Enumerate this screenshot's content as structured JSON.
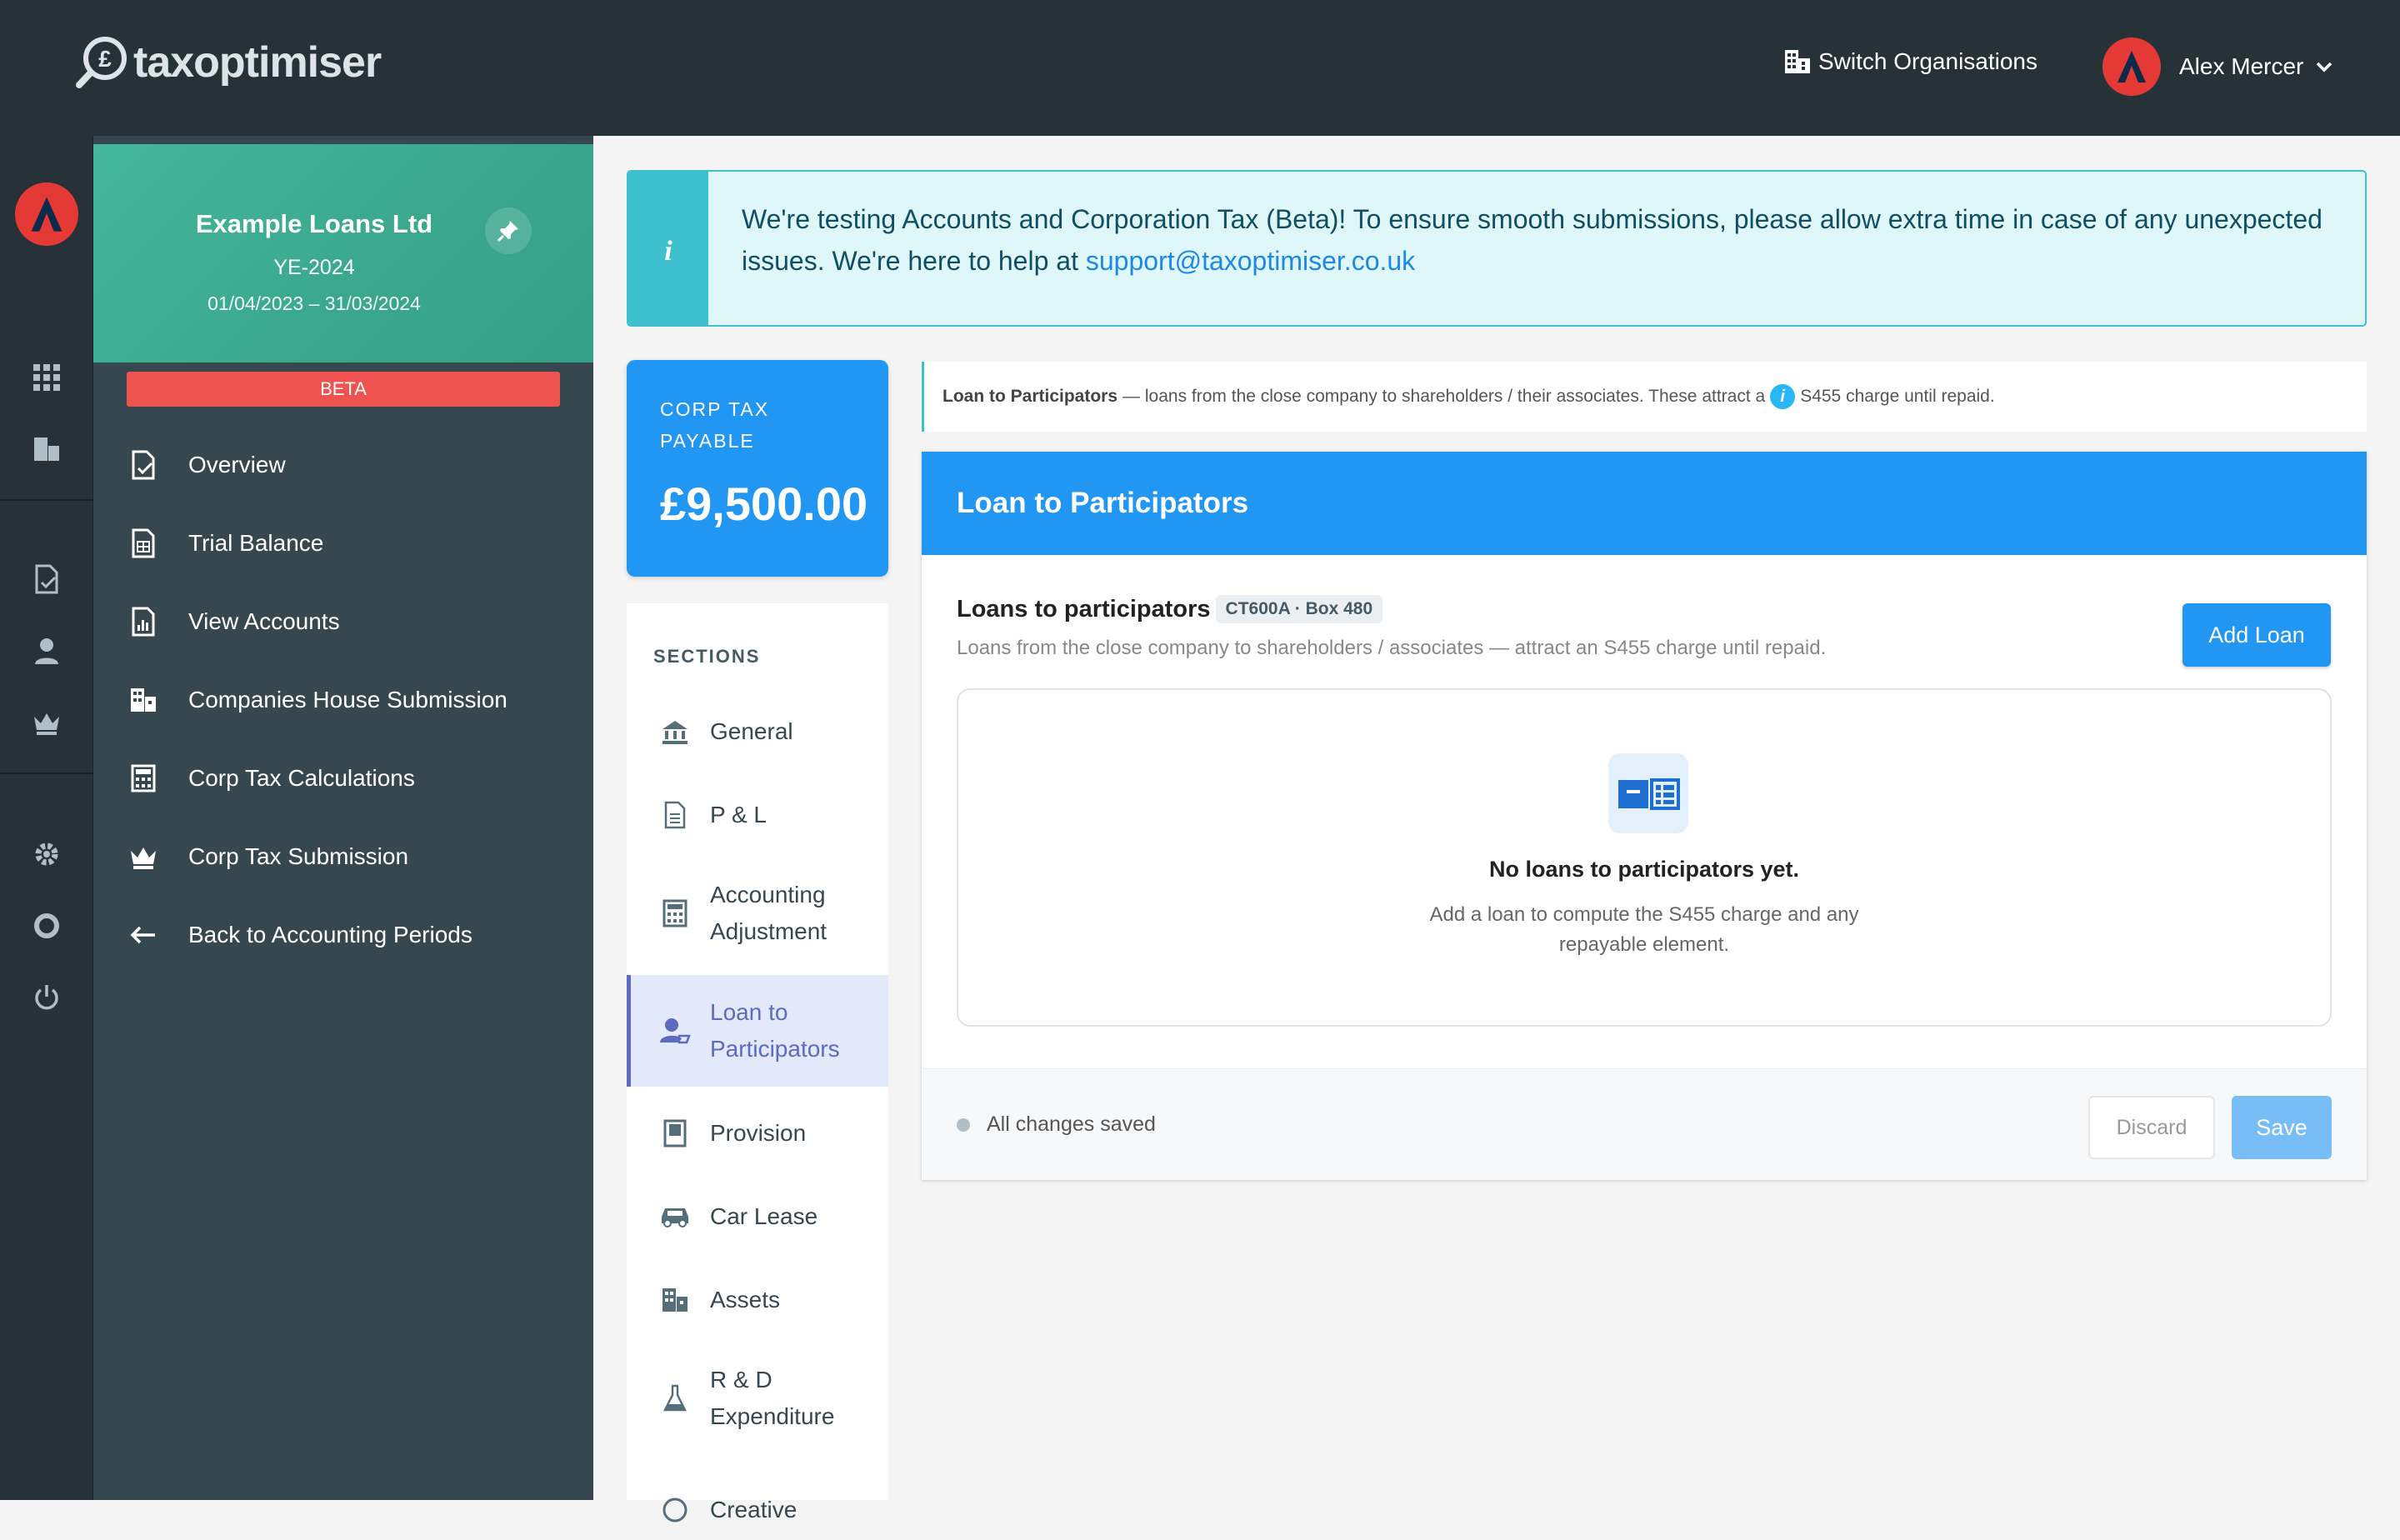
{
  "app": {
    "name": "taxoptimiser"
  },
  "header": {
    "switch_label": "Switch Organisations",
    "user_name": "Alex Mercer",
    "avatar_letter": "A"
  },
  "org": {
    "name": "Example Loans Ltd",
    "year_end": "YE-2024",
    "period": "01/04/2023 – 31/03/2024",
    "beta_label": "BETA"
  },
  "sidebar": {
    "items": [
      {
        "label": "Overview",
        "icon": "document-check-icon"
      },
      {
        "label": "Trial Balance",
        "icon": "spreadsheet-icon"
      },
      {
        "label": "View Accounts",
        "icon": "report-icon"
      },
      {
        "label": "Companies House Submission",
        "icon": "building-icon"
      },
      {
        "label": "Corp Tax Calculations",
        "icon": "calculator-icon"
      },
      {
        "label": "Corp Tax Submission",
        "icon": "crown-icon"
      },
      {
        "label": "Back to Accounting Periods",
        "icon": "arrow-left-icon"
      }
    ]
  },
  "banner": {
    "text": "We're testing Accounts and Corporation Tax (Beta)! To ensure smooth submissions, please allow extra time in case of any unexpected issues. We're here to help at ",
    "email": "support@taxoptimiser.co.uk"
  },
  "corp_tax": {
    "label": "CORP TAX PAYABLE",
    "value": "£9,500.00"
  },
  "sections": {
    "title": "SECTIONS",
    "items": [
      {
        "label": "General",
        "icon": "bank-icon"
      },
      {
        "label": "P & L",
        "icon": "document-icon"
      },
      {
        "label": "Accounting Adjustment",
        "icon": "calculator-icon"
      },
      {
        "label": "Loan to Participators",
        "icon": "person-loan-icon",
        "active": true
      },
      {
        "label": "Provision",
        "icon": "book-icon"
      },
      {
        "label": "Car Lease",
        "icon": "car-icon"
      },
      {
        "label": "Assets",
        "icon": "building-icon"
      },
      {
        "label": "R & D Expenditure",
        "icon": "flask-icon"
      },
      {
        "label": "Creative",
        "icon": "palette-icon"
      }
    ]
  },
  "help": {
    "title": "Loan to Participators",
    "text": "— loans from the close company to shareholders / their associates. These attract a",
    "info": "i",
    "suffix": "S455 charge until repaid."
  },
  "panel": {
    "title": "Loan to Participators",
    "loans_title": "Loans to participators",
    "badge": "CT600A · Box 480",
    "subtitle": "Loans from the close company to shareholders / associates — attract an S455 charge until repaid.",
    "add_button": "Add Loan",
    "empty_title": "No loans to participators yet.",
    "empty_text": "Add a loan to compute the S455 charge and any repayable element.",
    "status": "All changes saved",
    "discard": "Discard",
    "save": "Save"
  },
  "colors": {
    "primary": "#2196f3",
    "sidebar": "#37474f",
    "topbar": "#263238",
    "org_card": "#3aa78c",
    "beta": "#ef5350",
    "banner_bg": "#e0f7f9"
  }
}
